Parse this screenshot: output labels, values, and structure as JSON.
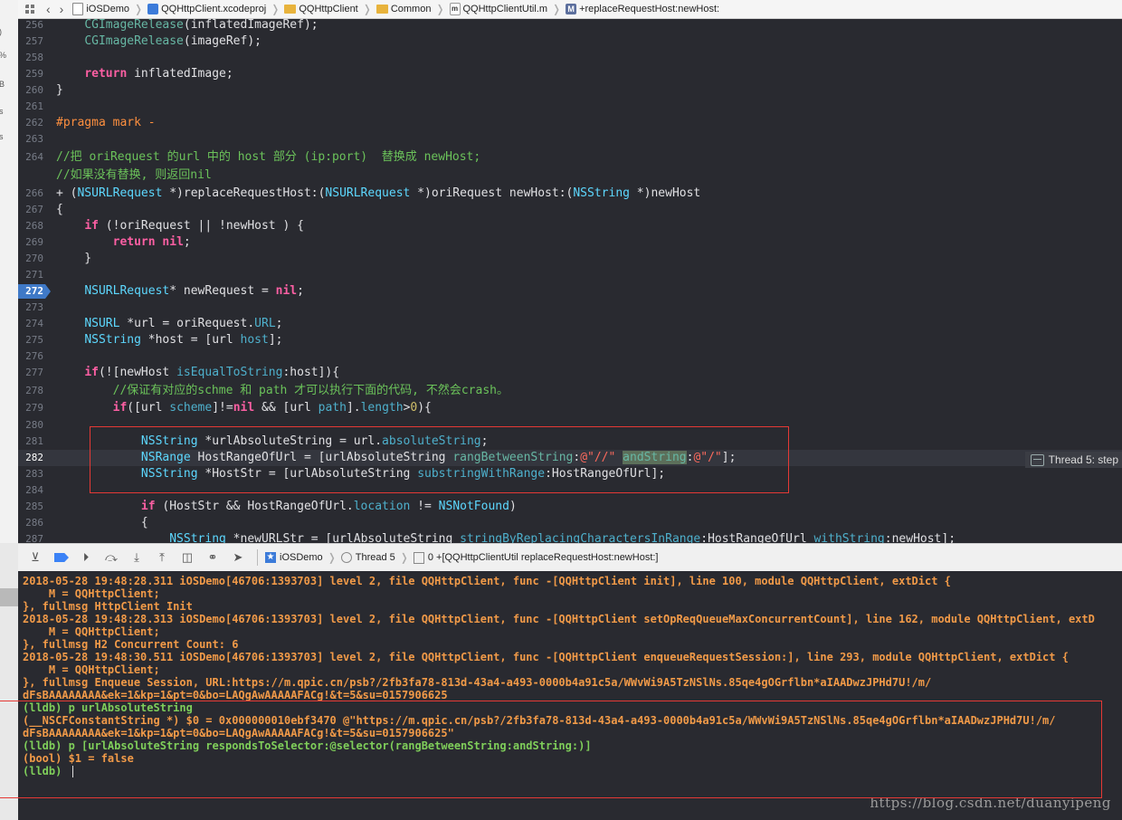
{
  "jumpbar": {
    "items": [
      "iOSDemo",
      "QQHttpClient.xcodeproj",
      "QQHttpClient",
      "Common",
      "QQHttpClientUtil.m",
      "+replaceRequestHost:newHost:"
    ]
  },
  "left_strip_chars": [
    ")",
    "%",
    "B",
    "s",
    "s"
  ],
  "editor": {
    "lines": [
      {
        "n": "256",
        "t": "    CGImageRelease(inflatedImageRef);"
      },
      {
        "n": "257",
        "t": "    CGImageRelease(imageRef);"
      },
      {
        "n": "258",
        "t": ""
      },
      {
        "n": "259",
        "t": "    return inflatedImage;"
      },
      {
        "n": "260",
        "t": "}"
      },
      {
        "n": "261",
        "t": ""
      },
      {
        "n": "262",
        "t": "#pragma mark -"
      },
      {
        "n": "263",
        "t": ""
      },
      {
        "n": "264",
        "t": "//把 oriRequest 的url 中的 host 部分 (ip:port)  替换成 newHost;"
      },
      {
        "n": "",
        "t": "//如果没有替换, 则返回nil"
      },
      {
        "n": "266",
        "t": "+ (NSURLRequest *)replaceRequestHost:(NSURLRequest *)oriRequest newHost:(NSString *)newHost"
      },
      {
        "n": "267",
        "t": "{"
      },
      {
        "n": "268",
        "t": "    if (!oriRequest || !newHost ) {"
      },
      {
        "n": "269",
        "t": "        return nil;"
      },
      {
        "n": "270",
        "t": "    }"
      },
      {
        "n": "271",
        "t": ""
      },
      {
        "n": "272",
        "t": "    NSURLRequest* newRequest = nil;"
      },
      {
        "n": "273",
        "t": ""
      },
      {
        "n": "274",
        "t": "    NSURL *url = oriRequest.URL;"
      },
      {
        "n": "275",
        "t": "    NSString *host = [url host];"
      },
      {
        "n": "276",
        "t": ""
      },
      {
        "n": "277",
        "t": "    if(![newHost isEqualToString:host]){"
      },
      {
        "n": "278",
        "t": "        //保证有对应的schme 和 path 才可以执行下面的代码, 不然会crash。"
      },
      {
        "n": "279",
        "t": "        if([url scheme]!=nil && [url path].length>0){"
      },
      {
        "n": "280",
        "t": ""
      },
      {
        "n": "281",
        "t": "            NSString *urlAbsoluteString = url.absoluteString;"
      },
      {
        "n": "282",
        "t": "            NSRange HostRangeOfUrl = [urlAbsoluteString rangBetweenString:@\"//\" andString:@\"/\"];"
      },
      {
        "n": "283",
        "t": "            NSString *HostStr = [urlAbsoluteString substringWithRange:HostRangeOfUrl];"
      },
      {
        "n": "284",
        "t": ""
      },
      {
        "n": "285",
        "t": "            if (HostStr && HostRangeOfUrl.location != NSNotFound)"
      },
      {
        "n": "286",
        "t": "            {"
      },
      {
        "n": "287",
        "t": "                NSString *newURLStr = [urlAbsoluteString stringByReplacingCharactersInRange:HostRangeOfUrl withString:newHost];"
      }
    ],
    "thread_badge": "Thread 5: step"
  },
  "debugbar": {
    "crumbs": [
      "iOSDemo",
      "Thread 5",
      "0 +[QQHttpClientUtil replaceRequestHost:newHost:]"
    ]
  },
  "console": {
    "lines": [
      {
        "c": "o",
        "t": "2018-05-28 19:48:28.311 iOSDemo[46706:1393703] level 2, file QQHttpClient, func -[QQHttpClient init], line 100, module QQHttpClient, extDict {"
      },
      {
        "c": "o",
        "t": "    M = QQHttpClient;"
      },
      {
        "c": "o",
        "t": "}, fullmsg HttpClient Init"
      },
      {
        "c": "o",
        "t": "2018-05-28 19:48:28.313 iOSDemo[46706:1393703] level 2, file QQHttpClient, func -[QQHttpClient setOpReqQueueMaxConcurrentCount], line 162, module QQHttpClient, extD"
      },
      {
        "c": "o",
        "t": "    M = QQHttpClient;"
      },
      {
        "c": "o",
        "t": "}, fullmsg H2 Concurrent Count: 6"
      },
      {
        "c": "o",
        "t": "2018-05-28 19:48:30.511 iOSDemo[46706:1393703] level 2, file QQHttpClient, func -[QQHttpClient enqueueRequestSession:], line 293, module QQHttpClient, extDict {"
      },
      {
        "c": "o",
        "t": "    M = QQHttpClient;"
      },
      {
        "c": "o",
        "t": "}, fullmsg Enqueue Session, URL:https://m.qpic.cn/psb?/2fb3fa78-813d-43a4-a493-0000b4a91c5a/WWvWi9A5TzNSlNs.85qe4gOGrflbn*aIAADwzJPHd7U!/m/"
      },
      {
        "c": "o",
        "t": "dFsBAAAAAAAA&ek=1&kp=1&pt=0&bo=LAQgAwAAAAAFACg!&t=5&su=0157906625"
      },
      {
        "c": "g",
        "t": "(lldb) p urlAbsoluteString"
      },
      {
        "c": "o",
        "t": "(__NSCFConstantString *) $0 = 0x000000010ebf3470 @\"https://m.qpic.cn/psb?/2fb3fa78-813d-43a4-a493-0000b4a91c5a/WWvWi9A5TzNSlNs.85qe4gOGrflbn*aIAADwzJPHd7U!/m/"
      },
      {
        "c": "o",
        "t": "dFsBAAAAAAAA&ek=1&kp=1&pt=0&bo=LAQgAwAAAAAFACg!&t=5&su=0157906625\""
      },
      {
        "c": "g",
        "t": "(lldb) p [urlAbsoluteString respondsToSelector:@selector(rangBetweenString:andString:)]"
      },
      {
        "c": "o",
        "t": "(bool) $1 = false"
      },
      {
        "c": "g",
        "t": "(lldb) "
      }
    ]
  },
  "watermark": "https://blog.csdn.net/duanyipeng",
  "colors": {
    "annotation_red": "#e53935",
    "breakpoint_blue": "#3f79c7",
    "editor_bg": "#292a30"
  }
}
